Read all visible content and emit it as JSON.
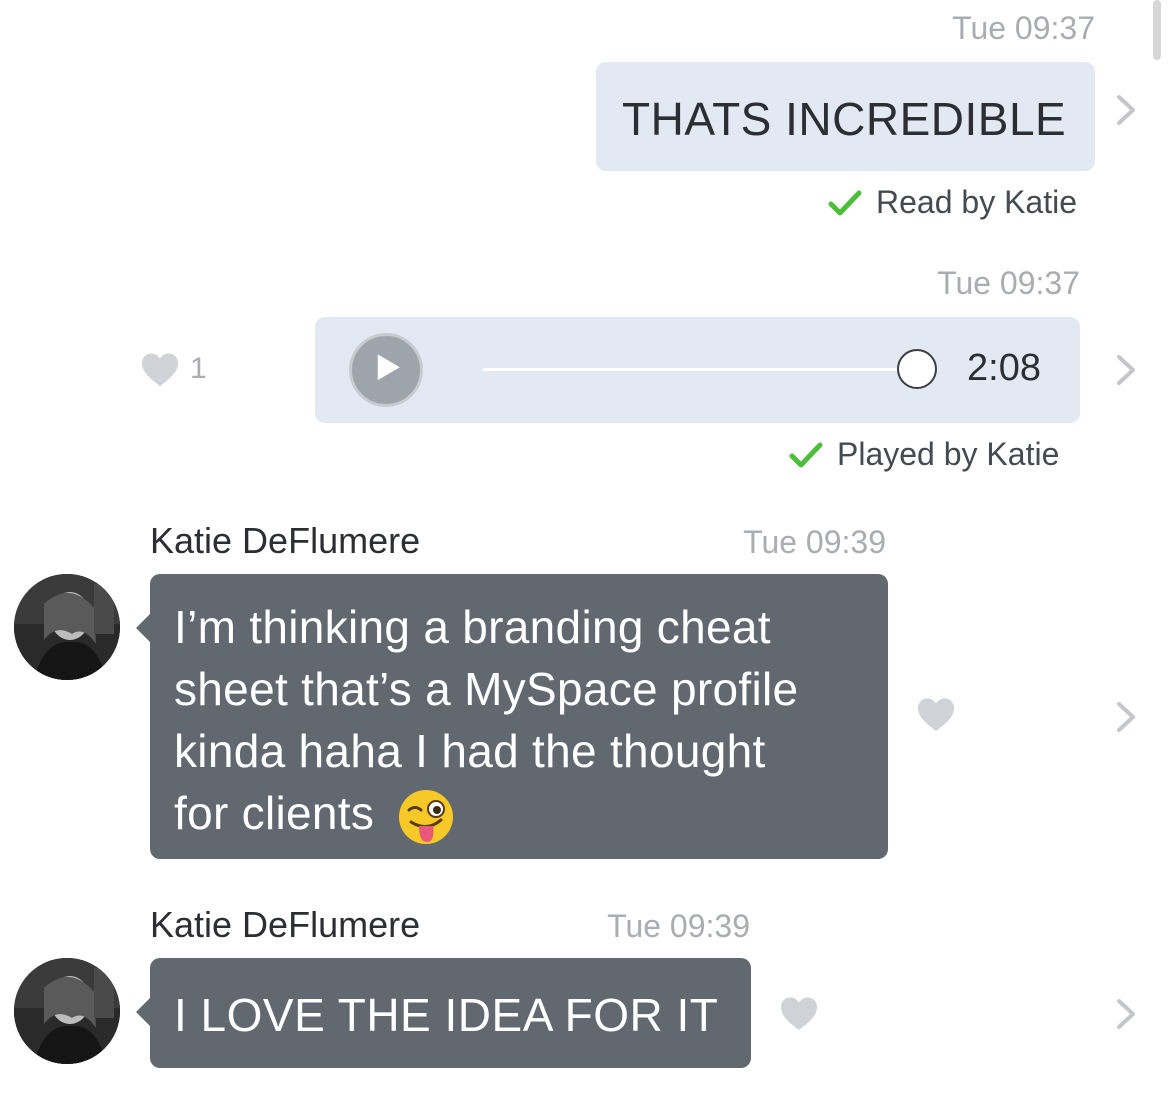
{
  "messages": {
    "m1": {
      "timestamp": "Tue 09:37",
      "text": "THATS INCREDIBLE",
      "status": "Read by Katie"
    },
    "m2": {
      "timestamp": "Tue 09:37",
      "likes": "1",
      "duration": "2:08",
      "status": "Played by Katie",
      "progress": 1.0
    },
    "m3": {
      "sender": "Katie DeFlumere",
      "timestamp": "Tue 09:39",
      "lines": [
        "I’m thinking a branding cheat",
        "sheet that’s a MySpace profile",
        "kinda haha I had the thought",
        "for clients"
      ],
      "emoji": "😜"
    },
    "m4": {
      "sender": "Katie DeFlumere",
      "timestamp": "Tue 09:39",
      "text": "I LOVE THE IDEA FOR IT"
    }
  },
  "colors": {
    "outgoing_bubble": "#e3e9f2",
    "incoming_bubble": "#616870",
    "check": "#4bbf3a",
    "timestamp": "#a9adb2"
  },
  "icons": {
    "chevron": "chevron-right-icon",
    "heart": "heart-icon",
    "check": "checkmark-icon",
    "play": "play-icon"
  }
}
